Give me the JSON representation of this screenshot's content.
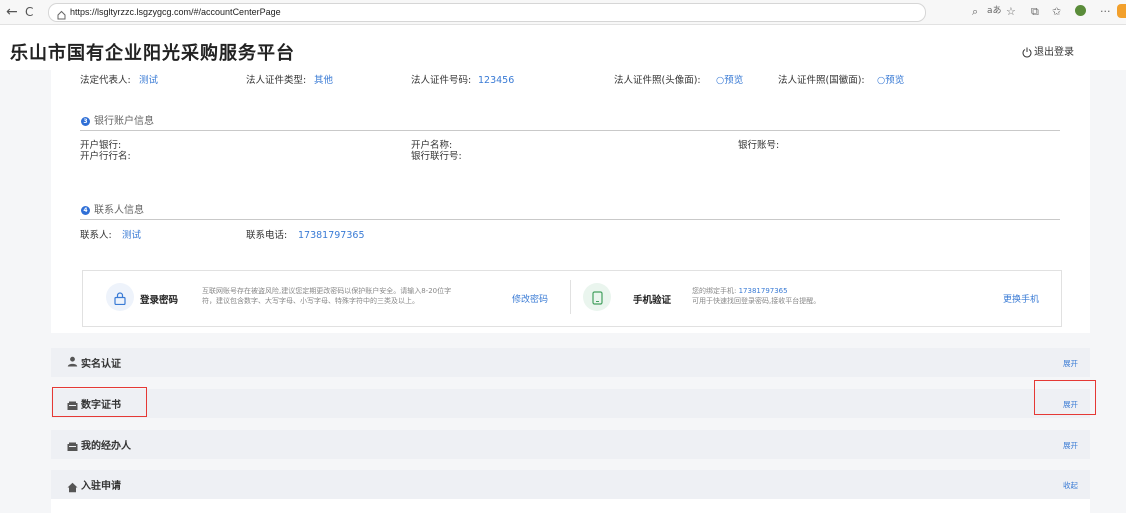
{
  "browser": {
    "url": "https://lsgltyrzzc.lsgzygcg.com/#/accountCenterPage",
    "back_icon": "←",
    "refresh_icon": "C",
    "reader_label": "aあ"
  },
  "header": {
    "title": "乐山市国有企业阳光采购服务平台",
    "logout": "退出登录"
  },
  "legal": {
    "rep_label": "法定代表人:",
    "rep_value": "测试",
    "id_type_label": "法人证件类型:",
    "id_type_value": "其他",
    "id_no_label": "法人证件号码:",
    "id_no_value": "123456",
    "photo_front_label": "法人证件照(头像面):",
    "photo_front_link": "预览",
    "photo_back_label": "法人证件照(国徽面):",
    "photo_back_link": "预览"
  },
  "bank": {
    "number": "3",
    "title": "银行账户信息",
    "bank_label": "开户银行:",
    "branch_label": "开户行行名:",
    "name_label": "开户名称:",
    "union_label": "银行联行号:",
    "account_label": "银行账号:"
  },
  "contact": {
    "number": "4",
    "title": "联系人信息",
    "person_label": "联系人:",
    "person_value": "测试",
    "phone_label": "联系电话:",
    "phone_value": "17381797365"
  },
  "security": {
    "pwd_title": "登录密码",
    "pwd_desc_1": "互联网账号存在被盗风险,建议您定期更改密码以保护账户安全。请输入8-20位字",
    "pwd_desc_2": "符，建议包含数字、大写字母、小写字母、特殊字符中的三类及以上。",
    "pwd_link": "修改密码",
    "phone_title": "手机验证",
    "phone_desc_prefix": "您的绑定手机:",
    "phone_desc_number": "17381797365",
    "phone_desc_2": "可用于快速找回登录密码,接收平台提醒。",
    "phone_link": "更换手机"
  },
  "panels": [
    {
      "title": "实名认证",
      "action": "展开"
    },
    {
      "title": "数字证书",
      "action": "展开"
    },
    {
      "title": "我的经办人",
      "action": "展开"
    },
    {
      "title": "入驻申请",
      "action": "收起"
    }
  ],
  "colors": {
    "accent": "#3a7bd5",
    "highlight": "#e53935"
  }
}
